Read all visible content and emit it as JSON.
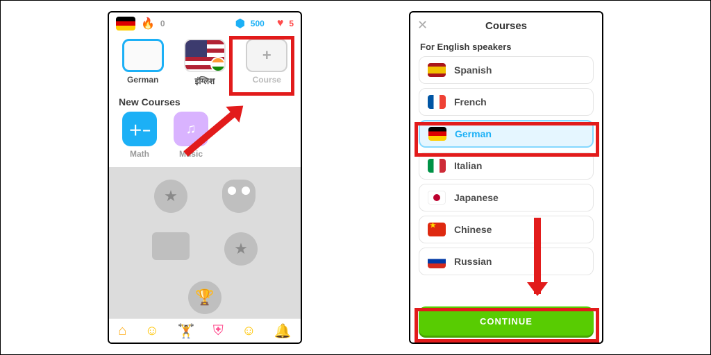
{
  "screen1": {
    "stats": {
      "streak": "0",
      "gems": "500",
      "hearts": "5"
    },
    "courses": [
      {
        "name": "German"
      },
      {
        "name": "इंग्लिश"
      },
      {
        "name": "Course"
      }
    ],
    "section_new": "New Courses",
    "new_courses": {
      "math": "Math",
      "music": "Music"
    }
  },
  "screen2": {
    "title": "Courses",
    "subtitle": "For English speakers",
    "languages": [
      {
        "name": "Spanish",
        "flag": "mf-es",
        "selected": false
      },
      {
        "name": "French",
        "flag": "mf-fr",
        "selected": false
      },
      {
        "name": "German",
        "flag": "mf-de",
        "selected": true
      },
      {
        "name": "Italian",
        "flag": "mf-it",
        "selected": false
      },
      {
        "name": "Japanese",
        "flag": "mf-jp",
        "selected": false
      },
      {
        "name": "Chinese",
        "flag": "mf-cn",
        "selected": false
      },
      {
        "name": "Russian",
        "flag": "mf-ru",
        "selected": false
      }
    ],
    "continue": "CONTINUE"
  }
}
